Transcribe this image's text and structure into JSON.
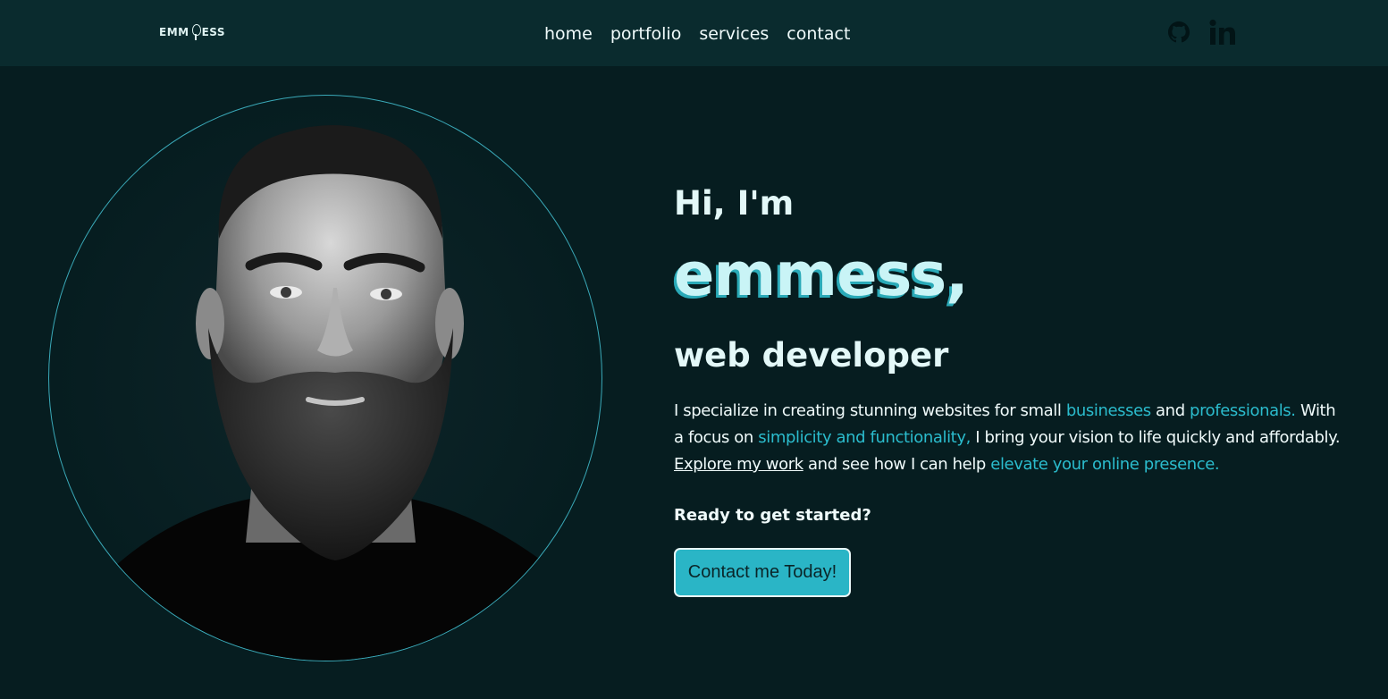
{
  "header": {
    "logo": {
      "left": "EMM",
      "right": "ESS"
    },
    "nav": [
      {
        "label": "home"
      },
      {
        "label": "portfolio"
      },
      {
        "label": "services"
      },
      {
        "label": "contact"
      }
    ],
    "social": [
      {
        "icon": "github-icon"
      },
      {
        "icon": "linkedin-icon"
      }
    ]
  },
  "hero": {
    "greeting": "Hi, I'm",
    "name": "emmess,",
    "role": "web developer",
    "intro": {
      "p1": "I specialize in creating stunning websites for small ",
      "h1": "businesses",
      "p2": " and ",
      "h2": "professionals.",
      "p3": " With a focus on ",
      "h3": "simplicity and functionality,",
      "p4": " I bring your vision to life quickly and affordably. ",
      "link": "Explore my work",
      "p5": " and see how I can help ",
      "h4": "elevate your online presence."
    },
    "ready": "Ready to get started?",
    "cta": "Contact me Today!"
  },
  "colors": {
    "background": "#061d20",
    "header": "#0a2b2e",
    "accent": "#2bbccd",
    "text": "#f0fbfb"
  }
}
